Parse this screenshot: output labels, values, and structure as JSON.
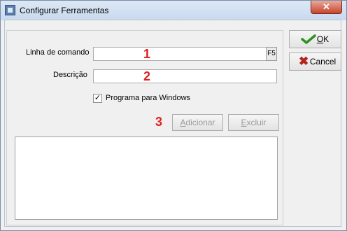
{
  "window": {
    "title": "Configurar Ferramentas",
    "close_label": "✕"
  },
  "form": {
    "command_label": "Linha de comando",
    "command_value": "",
    "f5_label": "F5",
    "description_label": "Descrição",
    "description_value": "",
    "windows_program_label": "Programa para Windows",
    "windows_program_checked": true,
    "checkmark": "✓"
  },
  "markers": [
    "1",
    "2",
    "3"
  ],
  "buttons": {
    "ok_accel": "O",
    "ok_rest": "K",
    "cancel_label": "Cancel",
    "add_accel": "A",
    "add_rest": "dicionar",
    "delete_accel": "E",
    "delete_rest": "xcluir"
  },
  "list": {
    "items": []
  },
  "colors": {
    "ok_check": "#2f8f1f",
    "cancel_x": "#b0241a",
    "marker": "#e02020",
    "close_button": "#c7452d"
  }
}
